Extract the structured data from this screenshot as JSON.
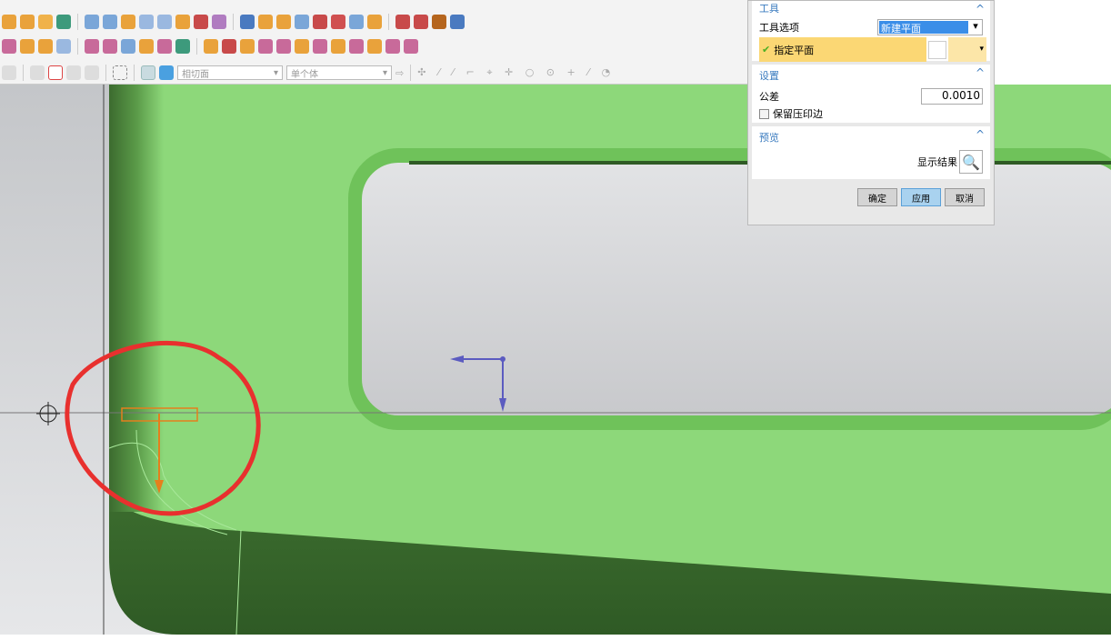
{
  "toolbar": {
    "face_filter": "相切面",
    "body_filter": "单个体"
  },
  "dialog": {
    "tool_section": {
      "title": "工具",
      "tool_option_label": "工具选项",
      "tool_option_value": "新建平面",
      "specify_plane": "指定平面"
    },
    "settings_section": {
      "title": "设置",
      "tolerance_label": "公差",
      "tolerance_value": "0.0010",
      "keep_imprint_label": "保留压印边",
      "keep_imprint_checked": false
    },
    "preview_section": {
      "title": "预览",
      "show_result_label": "显示结果"
    },
    "buttons": {
      "ok": "确定",
      "apply": "应用",
      "cancel": "取消"
    }
  },
  "colors": {
    "model_green": "#8dd87a",
    "highlight": "#fbd774",
    "annotation_red": "#e8302e",
    "vector_blue": "#5b5bc0",
    "orange": "#e57f1c"
  }
}
